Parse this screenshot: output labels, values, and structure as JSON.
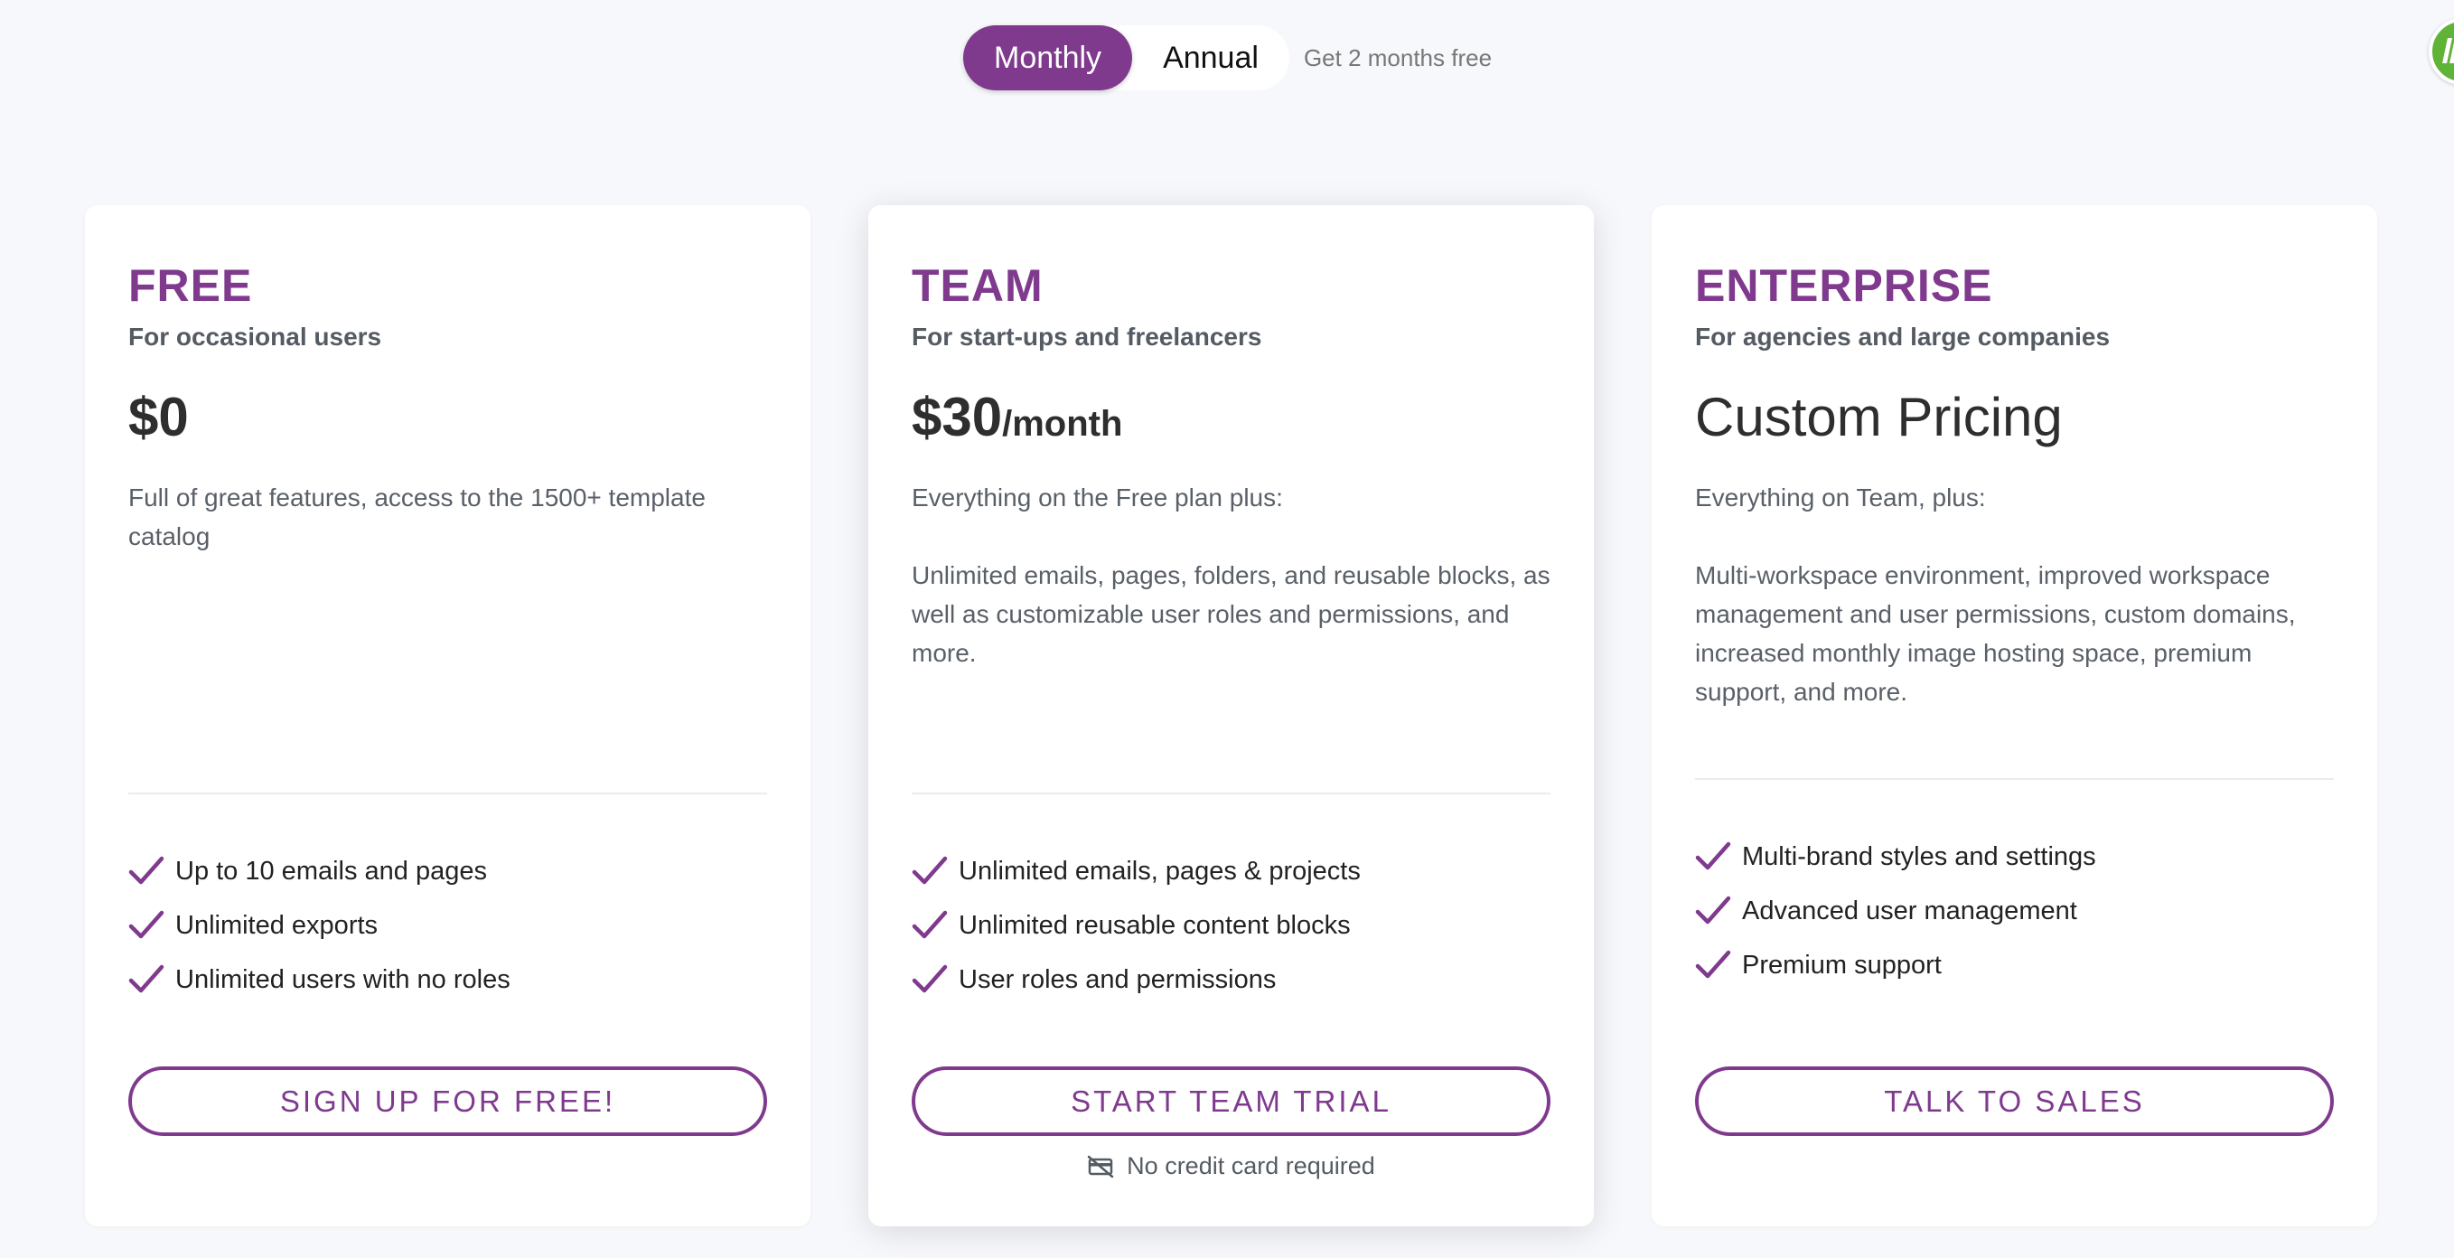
{
  "billing_toggle": {
    "monthly_label": "Monthly",
    "annual_label": "Annual",
    "note": "Get 2 months free",
    "selected": "Monthly"
  },
  "colors": {
    "accent": "#7f3a8e",
    "background": "#f7f8fb",
    "card": "#ffffff",
    "badge": "#5fb336"
  },
  "plans": {
    "free": {
      "name": "FREE",
      "tagline": "For occasional users",
      "price": "$0",
      "description": "Full of great features, access to the 1500+ template catalog",
      "features": [
        "Up to 10 emails and pages",
        "Unlimited exports",
        "Unlimited users with no roles"
      ],
      "cta": "SIGN UP FOR FREE!"
    },
    "team": {
      "name": "TEAM",
      "tagline": "For start-ups and freelancers",
      "price": "$30",
      "price_unit": "/month",
      "description_intro": "Everything on the Free plan plus:",
      "description": "Unlimited emails, pages, folders, and reusable blocks, as well as customizable user roles and permissions, and more.",
      "features": [
        "Unlimited emails, pages & projects",
        "Unlimited reusable content blocks",
        "User roles and permissions"
      ],
      "cta": "START TEAM TRIAL",
      "note": "No credit card required"
    },
    "enterprise": {
      "name": "ENTERPRISE",
      "tagline": "For agencies and large companies",
      "price": "Custom Pricing",
      "description_intro": "Everything on Team, plus:",
      "description": "Multi-workspace environment, improved workspace management and user permissions, custom domains, increased monthly image hosting space, premium support, and more.",
      "features": [
        "Multi-brand styles and settings",
        "Advanced user management",
        "Premium support"
      ],
      "cta": "TALK TO SALES"
    }
  },
  "icons": {
    "feature": "check-icon",
    "no_card": "no-credit-card-icon",
    "corner": "app-badge-icon"
  }
}
